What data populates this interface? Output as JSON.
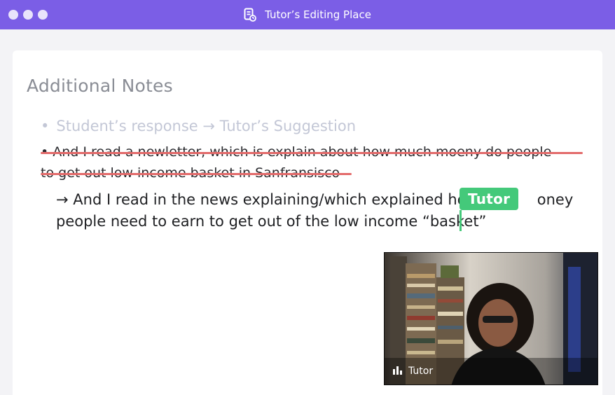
{
  "window": {
    "title": "Tutor’s Editing Place"
  },
  "document": {
    "heading": "Additional Notes",
    "legend_text": "Student’s response → Tutor’s Suggestion",
    "student_response": {
      "line1": "• And I read a newletter, which is explain about how much moeny do people",
      "line2": "to get out low income basket in Sanfransisco"
    },
    "tutor_suggestion": {
      "line1": "→ And I read in the news explaining/which explained how",
      "line1_end": "oney",
      "line2": "people need to earn to get out of the low income “basket”"
    }
  },
  "cursor_badge": {
    "label": "Tutor",
    "color": "#44c97a"
  },
  "video": {
    "participant_name": "Tutor"
  },
  "colors": {
    "titlebar": "#7b5ee6",
    "strike": "#e36a6a",
    "accent": "#44c97a"
  }
}
